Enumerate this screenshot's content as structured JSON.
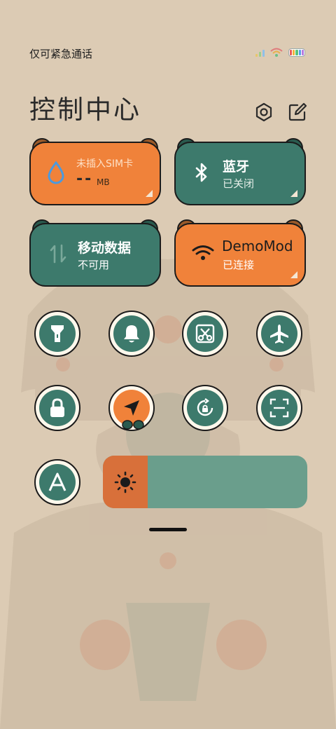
{
  "status_bar": {
    "carrier_text": "仅可紧急通话"
  },
  "header": {
    "title": "控制中心"
  },
  "tiles": {
    "data_usage": {
      "label": "未插入SIM卡",
      "value": "--",
      "unit": "MB"
    },
    "bluetooth": {
      "name": "蓝牙",
      "status": "已关闭"
    },
    "mobile_data": {
      "name": "移动数据",
      "status": "不可用"
    },
    "wifi": {
      "name": "DemoMod",
      "status": "已连接"
    }
  },
  "toggles": [
    {
      "name": "flashlight",
      "active": false
    },
    {
      "name": "bell",
      "active": false
    },
    {
      "name": "screenshot",
      "active": false
    },
    {
      "name": "airplane",
      "active": false
    },
    {
      "name": "lock",
      "active": false
    },
    {
      "name": "location",
      "active": true
    },
    {
      "name": "rotation-lock",
      "active": false
    },
    {
      "name": "scan",
      "active": false
    },
    {
      "name": "auto-brightness",
      "active": false
    }
  ],
  "brightness": {
    "level": 0.22
  },
  "colors": {
    "orange": "#f0823a",
    "green": "#3d7a6c",
    "background": "#dccbb4"
  }
}
